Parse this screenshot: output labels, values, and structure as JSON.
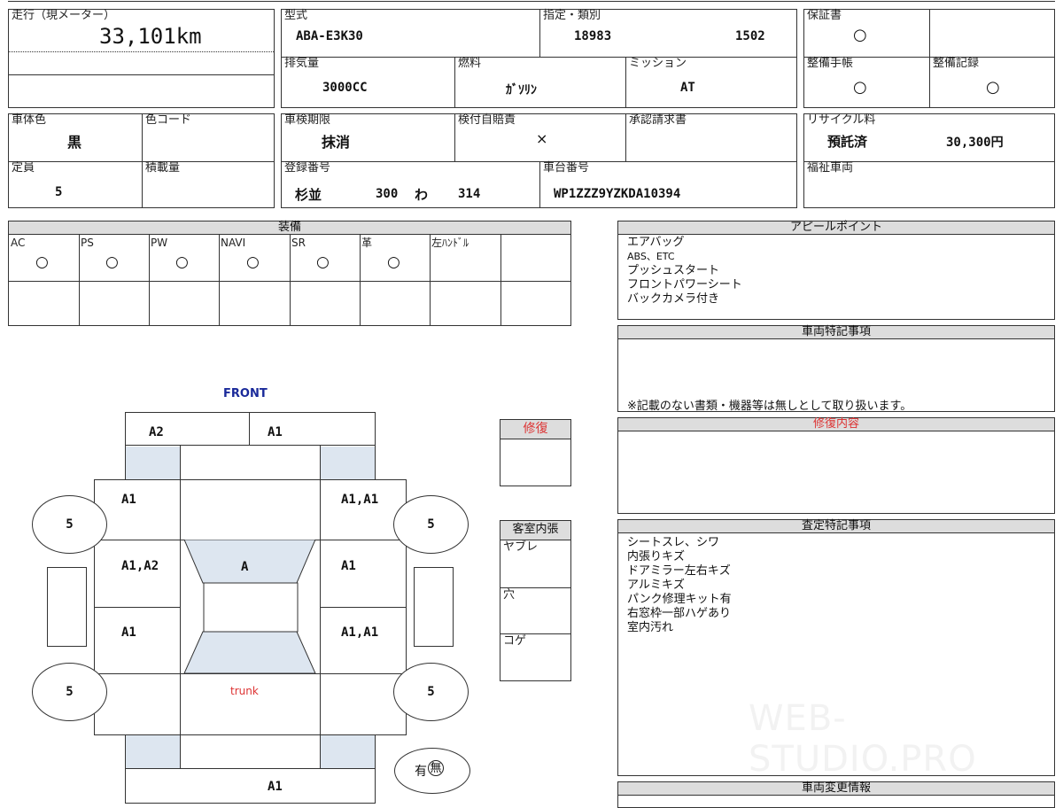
{
  "mileage": {
    "label": "走行（現メーター）",
    "value": "33,101km"
  },
  "model": {
    "label": "型式",
    "value": "ABA-E3K30"
  },
  "designation": {
    "label": "指定・類別",
    "number": "18983",
    "class": "1502"
  },
  "warranty": {
    "label": "保証書",
    "mark": "○"
  },
  "displacement": {
    "label": "排気量",
    "value": "3000CC"
  },
  "fuel": {
    "label": "燃料",
    "value": "ｶﾞｿﾘﾝ"
  },
  "transmission": {
    "label": "ミッション",
    "value": "AT"
  },
  "maintenance_book": {
    "label": "整備手帳",
    "mark": "○"
  },
  "maintenance_record": {
    "label": "整備記録",
    "mark": "○"
  },
  "body_color": {
    "label": "車体色",
    "value": "黒"
  },
  "color_code": {
    "label": "色コード",
    "value": ""
  },
  "inspection_expiry": {
    "label": "車検期限",
    "value": "抹消"
  },
  "insurance": {
    "label": "検付自賠責",
    "value": "×"
  },
  "approval": {
    "label": "承認請求書",
    "value": ""
  },
  "recycle": {
    "label": "リサイクル料",
    "status": "預託済",
    "amount": "30,300円"
  },
  "capacity": {
    "label": "定員",
    "value": "5"
  },
  "load_capacity": {
    "label": "積載量",
    "value": ""
  },
  "registration": {
    "label": "登録番号",
    "region": "杉並",
    "class": "300",
    "kana": "わ",
    "number": "314"
  },
  "chassis": {
    "label": "車台番号",
    "value": "WP1ZZZ9YZKDA10394"
  },
  "welfare": {
    "label": "福祉車両"
  },
  "equipment": {
    "title": "装備",
    "items": [
      {
        "label": "AC",
        "mark": "○"
      },
      {
        "label": "PS",
        "mark": "○"
      },
      {
        "label": "PW",
        "mark": "○"
      },
      {
        "label": "NAVI",
        "mark": "○"
      },
      {
        "label": "SR",
        "mark": "○"
      },
      {
        "label": "革",
        "mark": "○"
      },
      {
        "label": "左ﾊﾝﾄﾞﾙ",
        "mark": ""
      }
    ]
  },
  "appeal": {
    "title": "アピールポイント",
    "lines": [
      "エアバッグ",
      "ABS、ETC",
      "プッシュスタート",
      "フロントパワーシート",
      "バックカメラ付き"
    ]
  },
  "special_notes": {
    "title": "車両特記事項",
    "footer": "※記載のない書類・機器等は無しとして取り扱います。"
  },
  "repair": {
    "label": "修復"
  },
  "repair_details": {
    "title": "修復内容"
  },
  "interior": {
    "title": "客室内張",
    "rows": [
      "ヤブレ",
      "穴",
      "コゲ"
    ]
  },
  "assessment": {
    "title": "査定特記事項",
    "lines": [
      "シートスレ、シワ",
      "内張りキズ",
      "ドアミラー左右キズ",
      "アルミキズ",
      "パンク修理キット有",
      "右窓枠一部ハゲあり",
      "室内汚れ"
    ]
  },
  "vehicle_changes": {
    "title": "車両変更情報"
  },
  "diagram": {
    "front_label": "FRONT",
    "trunk_label": "trunk",
    "front_left": "A2",
    "front_right": "A1",
    "left_front_fender": "A1",
    "right_front_fender": "A1,A1",
    "left_front_door": "A1,A2",
    "roof": "A",
    "right_front_door": "A1",
    "left_rear_door": "A1",
    "right_rear_door": "A1,A1",
    "rear_bottom": "A1",
    "tire_fl": "5",
    "tire_fr": "5",
    "tire_rl": "5",
    "tire_rr": "5",
    "spare_yes": "有",
    "spare_no": "無"
  },
  "watermark": "WEB-STUDIO.PRO"
}
